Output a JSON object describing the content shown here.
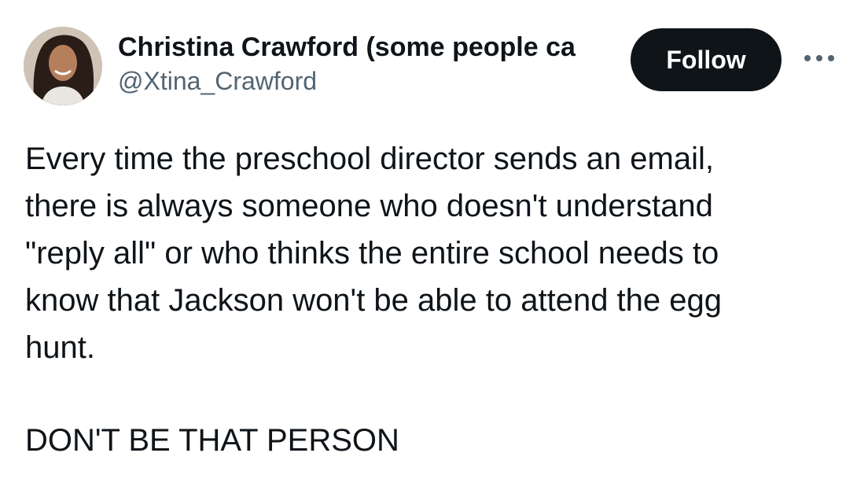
{
  "tweet": {
    "author": {
      "display_name": "Christina Crawford (some people ca",
      "handle": "@Xtina_Crawford",
      "avatar_icon": "profile-photo"
    },
    "follow_label": "Follow",
    "more_icon": "more-horizontal-icon",
    "text": "Every time the preschool director sends an email,\nthere is always someone who doesn't understand\n\"reply all\" or who thinks the entire school needs to\nknow that Jackson won't be able to attend the egg\nhunt.",
    "text_tail": "DON'T BE THAT PERSON"
  },
  "colors": {
    "text": "#0f1419",
    "secondary": "#536471",
    "button_bg": "#0f1419",
    "button_text": "#ffffff"
  }
}
